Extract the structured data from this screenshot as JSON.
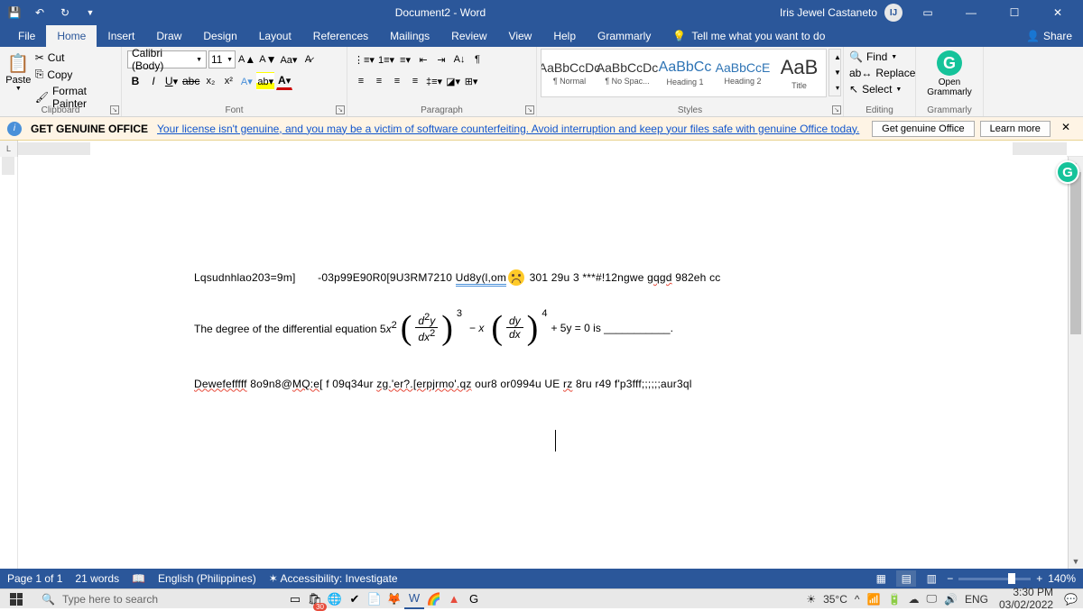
{
  "titlebar": {
    "title": "Document2 - Word",
    "user": "Iris Jewel Castaneto",
    "avatar_initial": "IJ"
  },
  "ribbon": {
    "tabs": [
      "File",
      "Home",
      "Insert",
      "Draw",
      "Design",
      "Layout",
      "References",
      "Mailings",
      "Review",
      "View",
      "Help",
      "Grammarly"
    ],
    "active_tab": "Home",
    "tellme": "Tell me what you want to do",
    "share": "Share"
  },
  "clipboard": {
    "paste": "Paste",
    "cut": "Cut",
    "copy": "Copy",
    "format_painter": "Format Painter",
    "label": "Clipboard"
  },
  "font": {
    "name": "Calibri (Body)",
    "size": "11",
    "label": "Font"
  },
  "paragraph": {
    "label": "Paragraph"
  },
  "styles": {
    "items": [
      {
        "preview": "AaBbCcDc",
        "name": "¶ Normal"
      },
      {
        "preview": "AaBbCcDc",
        "name": "¶ No Spac..."
      },
      {
        "preview": "AaBbCc",
        "name": "Heading 1"
      },
      {
        "preview": "AaBbCcE",
        "name": "Heading 2"
      },
      {
        "preview": "AaB",
        "name": "Title"
      }
    ],
    "label": "Styles"
  },
  "editing": {
    "find": "Find",
    "replace": "Replace",
    "select": "Select",
    "label": "Editing"
  },
  "grammarly": {
    "open": "Open Grammarly",
    "label": "Grammarly"
  },
  "warning": {
    "bold": "GET GENUINE OFFICE",
    "text": "Your license isn't genuine, and you may be a victim of software counterfeiting. Avoid interruption and keep your files safe with genuine Office today.",
    "btn1": "Get genuine Office",
    "btn2": "Learn more"
  },
  "document": {
    "line1_a": "Lqsudnhlao203=9m]",
    "line1_b": "-03p99E90R0[9U3RM7210 ",
    "line1_c": "Ud8y(l,om",
    "line1_d": " 301 29u 3 ***#!12ngwe ",
    "line1_e": "gqgd",
    "line1_f": " 982eh cc",
    "eq_prefix": "The degree of the differential equation  5",
    "eq_suffix": "+ 5y = 0 is ___________.",
    "line3_a": "Dewefefffff",
    "line3_b": " 8o9n8@",
    "line3_c": "MQ:e",
    "line3_d": "[ f 09q34ur ",
    "line3_e": "zg.'er?.[erpjrmo'.qz",
    "line3_f": " our8 or0994u  UE  ",
    "line3_g": "rz",
    "line3_h": " 8ru r49 f'p3fff;;;;;;aur3ql"
  },
  "statusbar": {
    "page": "Page 1 of 1",
    "words": "21 words",
    "lang": "English (Philippines)",
    "access": "Accessibility: Investigate",
    "zoom": "140%"
  },
  "taskbar": {
    "search": "Type here to search",
    "badge": "30",
    "temp": "35°C",
    "lang": "ENG",
    "time": "3:30 PM",
    "date": "03/02/2022"
  }
}
